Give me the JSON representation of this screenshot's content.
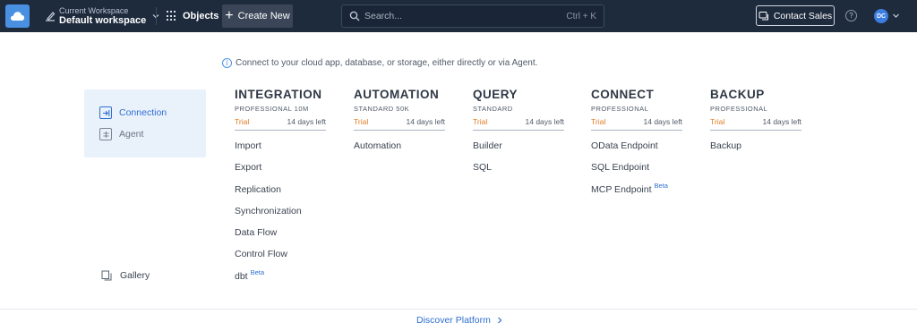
{
  "topbar": {
    "workspace_label": "Current Workspace",
    "workspace_name": "Default workspace",
    "objects_label": "Objects",
    "create_label": "Create New",
    "search_placeholder": "Search...",
    "search_shortcut": "Ctrl + K",
    "contact_label": "Contact Sales",
    "help_glyph": "?",
    "avatar_initials": "DC"
  },
  "info_text": "Connect to your cloud app, database, or storage, either directly or via Agent.",
  "sidebar": {
    "items": [
      {
        "label": "Connection",
        "icon": "connection-icon",
        "active": true
      },
      {
        "label": "Agent",
        "icon": "agent-icon",
        "active": false
      }
    ],
    "gallery_label": "Gallery"
  },
  "products": [
    {
      "title": "INTEGRATION",
      "edition": "PROFESSIONAL 10M",
      "trial": "Trial",
      "days": "14 days left",
      "items": [
        {
          "label": "Import"
        },
        {
          "label": "Export"
        },
        {
          "label": "Replication"
        },
        {
          "label": "Synchronization"
        },
        {
          "label": "Data Flow"
        },
        {
          "label": "Control Flow"
        },
        {
          "label": "dbt",
          "badge": "Beta"
        }
      ]
    },
    {
      "title": "AUTOMATION",
      "edition": "STANDARD 50K",
      "trial": "Trial",
      "days": "14 days left",
      "items": [
        {
          "label": "Automation"
        }
      ]
    },
    {
      "title": "QUERY",
      "edition": "STANDARD",
      "trial": "Trial",
      "days": "14 days left",
      "items": [
        {
          "label": "Builder"
        },
        {
          "label": "SQL"
        }
      ]
    },
    {
      "title": "CONNECT",
      "edition": "PROFESSIONAL",
      "trial": "Trial",
      "days": "14 days left",
      "items": [
        {
          "label": "OData Endpoint"
        },
        {
          "label": "SQL Endpoint"
        },
        {
          "label": "MCP Endpoint",
          "badge": "Beta"
        }
      ]
    },
    {
      "title": "BACKUP",
      "edition": "PROFESSIONAL",
      "trial": "Trial",
      "days": "14 days left",
      "items": [
        {
          "label": "Backup"
        }
      ]
    }
  ],
  "footer": {
    "discover_label": "Discover Platform"
  },
  "colors": {
    "accent": "#2f6fd0",
    "trial": "#e07a1f",
    "topbar": "#1e2b3d",
    "sidebar_bg": "#e9f1fb"
  }
}
